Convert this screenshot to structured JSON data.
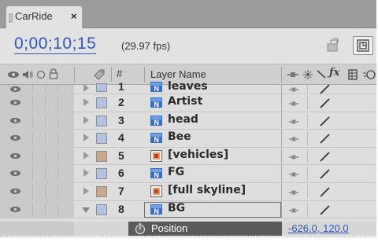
{
  "composition": {
    "tab_title": "CarRide",
    "close_glyph": "×",
    "timecode": "0;00;10;15",
    "fps": "(29.97 fps)"
  },
  "header": {
    "icons": [
      "eye-icon",
      "speaker-icon",
      "solo-icon",
      "lock-icon",
      "label-tag-icon"
    ],
    "number_col": "#",
    "name_col": "Layer Name",
    "switch_icons": [
      "shy-icon",
      "collapse-icon",
      "quality-icon",
      "fx-icon",
      "frame-blend-icon",
      "motion-blur-icon"
    ]
  },
  "layers": [
    {
      "num": "1",
      "name": "leaves",
      "type": "photoshop",
      "label_color": "#b3c1e2",
      "expanded": false
    },
    {
      "num": "2",
      "name": "Artist",
      "type": "photoshop",
      "label_color": "#b3c1e2",
      "expanded": false
    },
    {
      "num": "3",
      "name": "head",
      "type": "photoshop",
      "label_color": "#b3c1e2",
      "expanded": false
    },
    {
      "num": "4",
      "name": "Bee",
      "type": "photoshop",
      "label_color": "#b3c1e2",
      "expanded": false
    },
    {
      "num": "5",
      "name": "[vehicles]",
      "type": "precomp",
      "label_color": "#c9a98a",
      "expanded": false
    },
    {
      "num": "6",
      "name": "FG",
      "type": "photoshop",
      "label_color": "#b3c1e2",
      "expanded": false
    },
    {
      "num": "7",
      "name": "[full skyline]",
      "type": "precomp",
      "label_color": "#c9a98a",
      "expanded": false
    },
    {
      "num": "8",
      "name": "BG",
      "type": "photoshop",
      "label_color": "#b3c1e2",
      "expanded": true
    }
  ],
  "property": {
    "name": "Position",
    "value": "-626.0, 120.0"
  },
  "colors": {
    "accent_blue": "#2f57b4",
    "panel_bg": "#dedede",
    "tab_bar": "#9c9c9c"
  }
}
